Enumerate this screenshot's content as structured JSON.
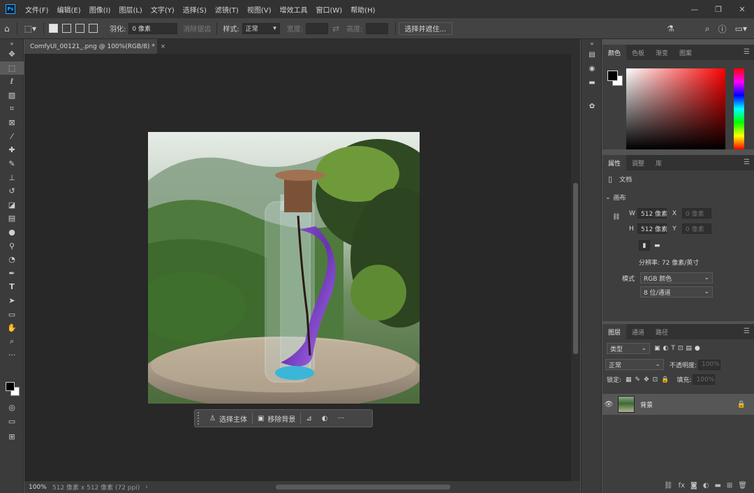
{
  "app": {
    "logo": "Ps",
    "document_tab": "ComfyUI_00121_.png @ 100%(RGB/8) *"
  },
  "menu": [
    "文件(F)",
    "编辑(E)",
    "图像(I)",
    "图层(L)",
    "文字(Y)",
    "选择(S)",
    "滤镜(T)",
    "视图(V)",
    "增效工具",
    "窗口(W)",
    "帮助(H)"
  ],
  "window_controls": {
    "minimize": "—",
    "restore": "❐",
    "close": "✕"
  },
  "options": {
    "feather_label": "羽化:",
    "feather_value": "0 像素",
    "antialias_label": "消除锯齿",
    "style_label": "样式:",
    "style_value": "正常",
    "width_label": "宽度:",
    "height_label": "高度:",
    "select_mask_button": "选择并遮住..."
  },
  "canvas": {
    "zoom": "100%",
    "doc_size": "512 像素 x 512 像素 (72 ppi)"
  },
  "context_bar": {
    "select_subject": "选择主体",
    "remove_background": "移除背景",
    "more": "···"
  },
  "color_panel": {
    "tabs": [
      "颜色",
      "色板",
      "渐变",
      "图案"
    ],
    "foreground": "#000000",
    "background": "#ffffff"
  },
  "properties_panel": {
    "tabs": [
      "属性",
      "调整",
      "库"
    ],
    "doc_label": "文档",
    "canvas_section": "画布",
    "w_label": "W",
    "w_value": "512 像素",
    "h_label": "H",
    "h_value": "512 像素",
    "x_label": "X",
    "x_value": "0 像素",
    "y_label": "Y",
    "y_value": "0 像素",
    "resolution": "分辨率: 72 像素/英寸",
    "mode_label": "模式",
    "mode_value": "RGB 颜色",
    "depth_value": "8 位/通道"
  },
  "layers_panel": {
    "tabs": [
      "图层",
      "通道",
      "路径"
    ],
    "filter_label": "类型",
    "blend_mode": "正常",
    "opacity_label": "不透明度:",
    "opacity_value": "100%",
    "lock_label": "锁定:",
    "fill_label": "填充:",
    "fill_value": "100%",
    "layer_name": "背景"
  }
}
